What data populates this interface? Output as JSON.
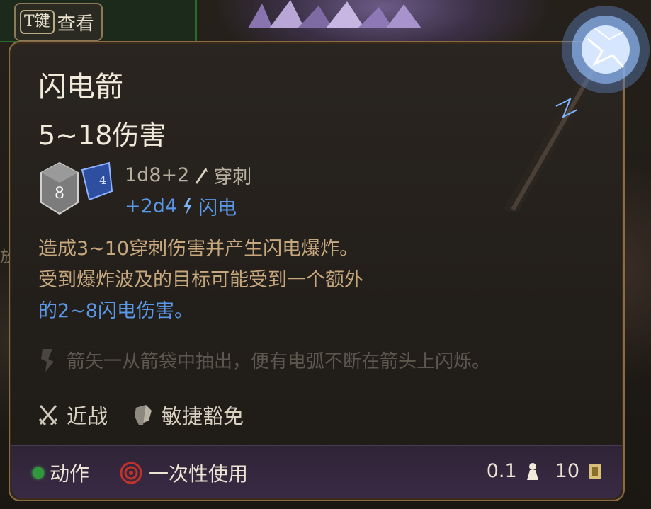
{
  "background": {
    "key_hint": {
      "key": "T键",
      "label": "查看"
    },
    "side_fragment": "放"
  },
  "tooltip": {
    "title": "闪电箭",
    "damage_total": "5~18伤害",
    "damage_lines": [
      {
        "dice": "1d8+2",
        "type": "穿刺",
        "icon": "pierce-icon",
        "color": "#b6ae9f"
      },
      {
        "dice": "+2d4",
        "type": "闪电",
        "icon": "lightning-icon",
        "color": "#5b97e8"
      }
    ],
    "dice_icons": {
      "d8": "8",
      "d4": "4"
    },
    "description": {
      "line1": "造成3~10穿刺伤害并产生闪电爆炸。",
      "line2": "受到爆炸波及的目标可能受到一个额外",
      "line3_prefix": "的",
      "line3_highlight": "2~8闪电伤害",
      "line3_suffix": "。"
    },
    "flavor": "箭矢一从箭袋中抽出，便有电弧不断在箭头上闪烁。",
    "tags": [
      {
        "label": "近战",
        "icon": "crossed-swords-icon"
      },
      {
        "label": "敏捷豁免",
        "icon": "shield-save-icon"
      }
    ],
    "footer": {
      "action_label": "动作",
      "usage_label": "一次性使用",
      "weight": "0.1",
      "value": "10"
    }
  },
  "colors": {
    "text_primary": "#f1eadb",
    "description": "#c7a77e",
    "lightning": "#5b97e8",
    "action_dot": "#2f9a3c",
    "border": "#8a6b44"
  }
}
